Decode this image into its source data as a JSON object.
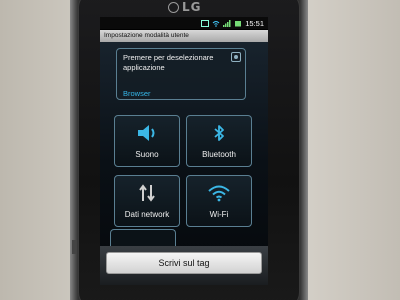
{
  "device": {
    "brand": "LG"
  },
  "status_bar": {
    "time": "15:51"
  },
  "screen_title": "Impostazione modalità utente",
  "nfc_card": {
    "message": "Premere per deselezionare applicazione",
    "app": "Browser"
  },
  "tiles": [
    {
      "label": "Suono",
      "icon": "speaker-icon"
    },
    {
      "label": "Bluetooth",
      "icon": "bluetooth-icon"
    },
    {
      "label": "Dati network",
      "icon": "data-arrows-icon"
    },
    {
      "label": "Wi-Fi",
      "icon": "wifi-icon"
    }
  ],
  "write_button": "Scrivi sul tag",
  "colors": {
    "accent": "#35b6e8",
    "tile_border": "#5a7f92"
  }
}
